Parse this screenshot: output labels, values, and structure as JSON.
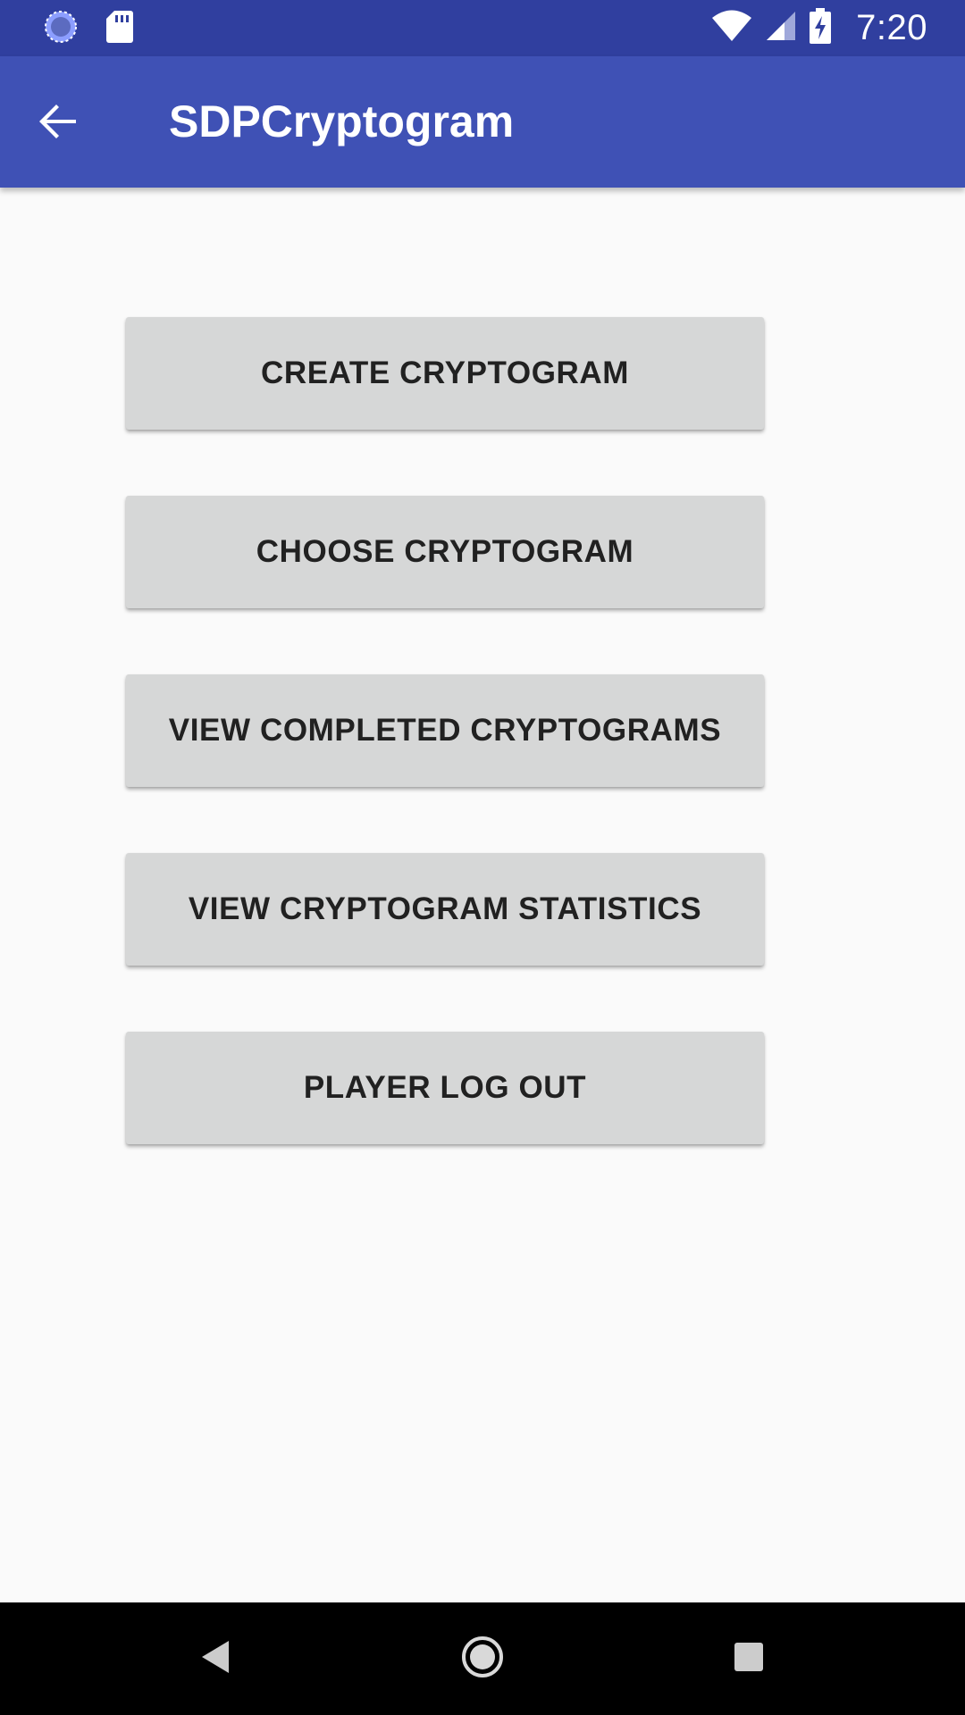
{
  "status_bar": {
    "time": "7:20",
    "left_icons": [
      "sync-icon",
      "sd-card-icon"
    ],
    "right_icons": [
      "wifi-icon",
      "cell-signal-icon",
      "battery-charging-icon"
    ]
  },
  "app_bar": {
    "title": "SDPCryptogram",
    "back_icon": "arrow-back-icon"
  },
  "menu": {
    "buttons": [
      {
        "label": "CREATE CRYPTOGRAM"
      },
      {
        "label": "CHOOSE CRYPTOGRAM"
      },
      {
        "label": "VIEW COMPLETED CRYPTOGRAMS"
      },
      {
        "label": "VIEW CRYPTOGRAM STATISTICS"
      },
      {
        "label": "PLAYER LOG OUT"
      }
    ]
  },
  "nav_bar": {
    "buttons": [
      "nav-back-icon",
      "nav-home-icon",
      "nav-recents-icon"
    ]
  },
  "colors": {
    "status_bar": "#303f9f",
    "app_bar": "#3f51b5",
    "background": "#fafafa",
    "button": "#d6d7d7",
    "button_text": "#212121",
    "nav_bar": "#000000"
  }
}
